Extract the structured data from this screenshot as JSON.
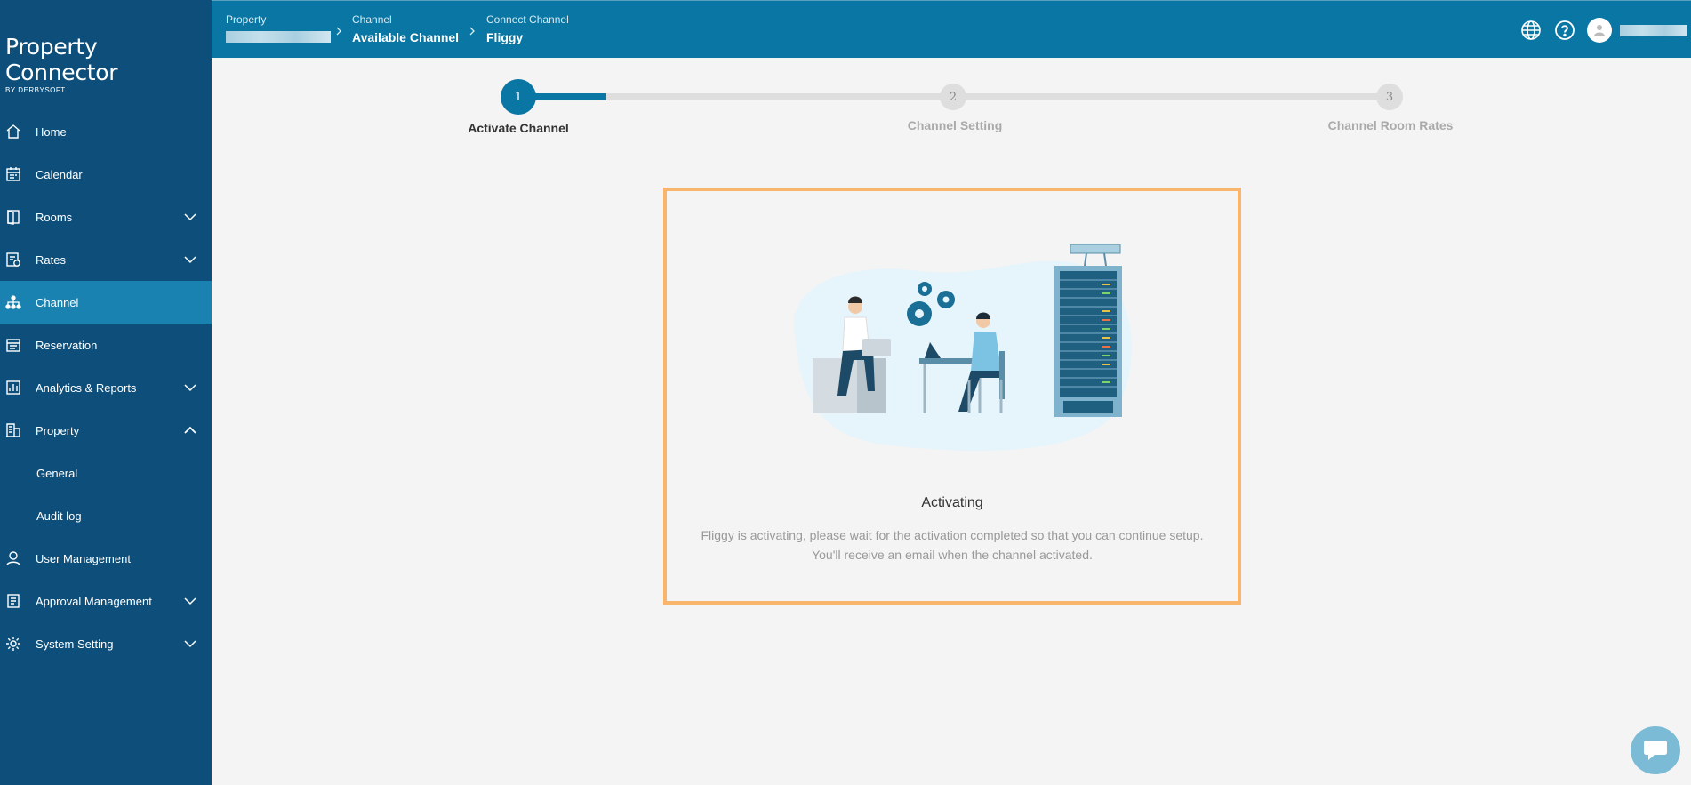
{
  "app": {
    "logo_title": "Property Connector",
    "logo_sub": "BY DERBYSOFT"
  },
  "sidebar": {
    "items": [
      {
        "label": "Home",
        "icon": "home-icon"
      },
      {
        "label": "Calendar",
        "icon": "calendar-icon"
      },
      {
        "label": "Rooms",
        "icon": "door-icon",
        "expandable": true
      },
      {
        "label": "Rates",
        "icon": "rates-icon",
        "expandable": true
      },
      {
        "label": "Channel",
        "icon": "channel-icon",
        "active": true
      },
      {
        "label": "Reservation",
        "icon": "reservation-icon"
      },
      {
        "label": "Analytics & Reports",
        "icon": "analytics-icon",
        "expandable": true
      },
      {
        "label": "Property",
        "icon": "building-icon",
        "expanded": true
      },
      {
        "label": "User Management",
        "icon": "user-icon"
      },
      {
        "label": "Approval Management",
        "icon": "approval-icon",
        "expandable": true
      },
      {
        "label": "System Setting",
        "icon": "gear-icon",
        "expandable": true
      }
    ],
    "property_sub": [
      {
        "label": "General"
      },
      {
        "label": "Audit log"
      }
    ]
  },
  "breadcrumb": {
    "property_label": "Property",
    "channel_label": "Channel",
    "channel_value": "Available Channel",
    "connect_label": "Connect Channel",
    "connect_value": "Fliggy"
  },
  "stepper": {
    "current": 1,
    "steps": [
      {
        "number": "1",
        "label": "Activate Channel"
      },
      {
        "number": "2",
        "label": "Channel Setting"
      },
      {
        "number": "3",
        "label": "Channel Room Rates"
      }
    ]
  },
  "card": {
    "title": "Activating",
    "desc_line1": "Fliggy is activating, please wait for the activation completed so that you can continue setup.",
    "desc_line2": "You'll receive an email when the channel activated."
  },
  "colors": {
    "sidebar_bg": "#0d4f7a",
    "topbar_bg": "#0a76a3",
    "active_nav": "#1a82b0",
    "card_border": "#f8b56b"
  }
}
